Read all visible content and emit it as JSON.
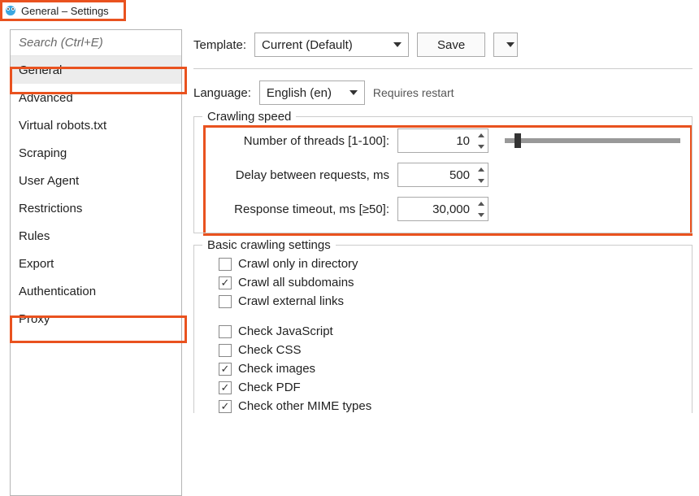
{
  "window": {
    "title": "General – Settings"
  },
  "sidebar": {
    "search_placeholder": "Search (Ctrl+E)",
    "items": [
      "General",
      "Advanced",
      "Virtual robots.txt",
      "Scraping",
      "User Agent",
      "Restrictions",
      "Rules",
      "Export",
      "Authentication",
      "Proxy"
    ],
    "selected_index": 0
  },
  "toolbar": {
    "template_label": "Template:",
    "template_value": "Current (Default)",
    "save_label": "Save"
  },
  "language": {
    "label": "Language:",
    "value": "English (en)",
    "hint": "Requires restart"
  },
  "crawl_speed": {
    "legend": "Crawling speed",
    "threads_label": "Number of threads [1-100]:",
    "threads_value": "10",
    "delay_label": "Delay between requests, ms",
    "delay_value": "500",
    "timeout_label": "Response timeout, ms [≥50]:",
    "timeout_value": "30,000"
  },
  "basic": {
    "legend": "Basic crawling settings",
    "options": [
      {
        "label": "Crawl only in directory",
        "checked": false
      },
      {
        "label": "Crawl all subdomains",
        "checked": true
      },
      {
        "label": "Crawl external links",
        "checked": false
      }
    ],
    "options2": [
      {
        "label": "Check JavaScript",
        "checked": false
      },
      {
        "label": "Check CSS",
        "checked": false
      },
      {
        "label": "Check images",
        "checked": true
      },
      {
        "label": "Check PDF",
        "checked": true
      },
      {
        "label": "Check other MIME types",
        "checked": true
      }
    ]
  }
}
